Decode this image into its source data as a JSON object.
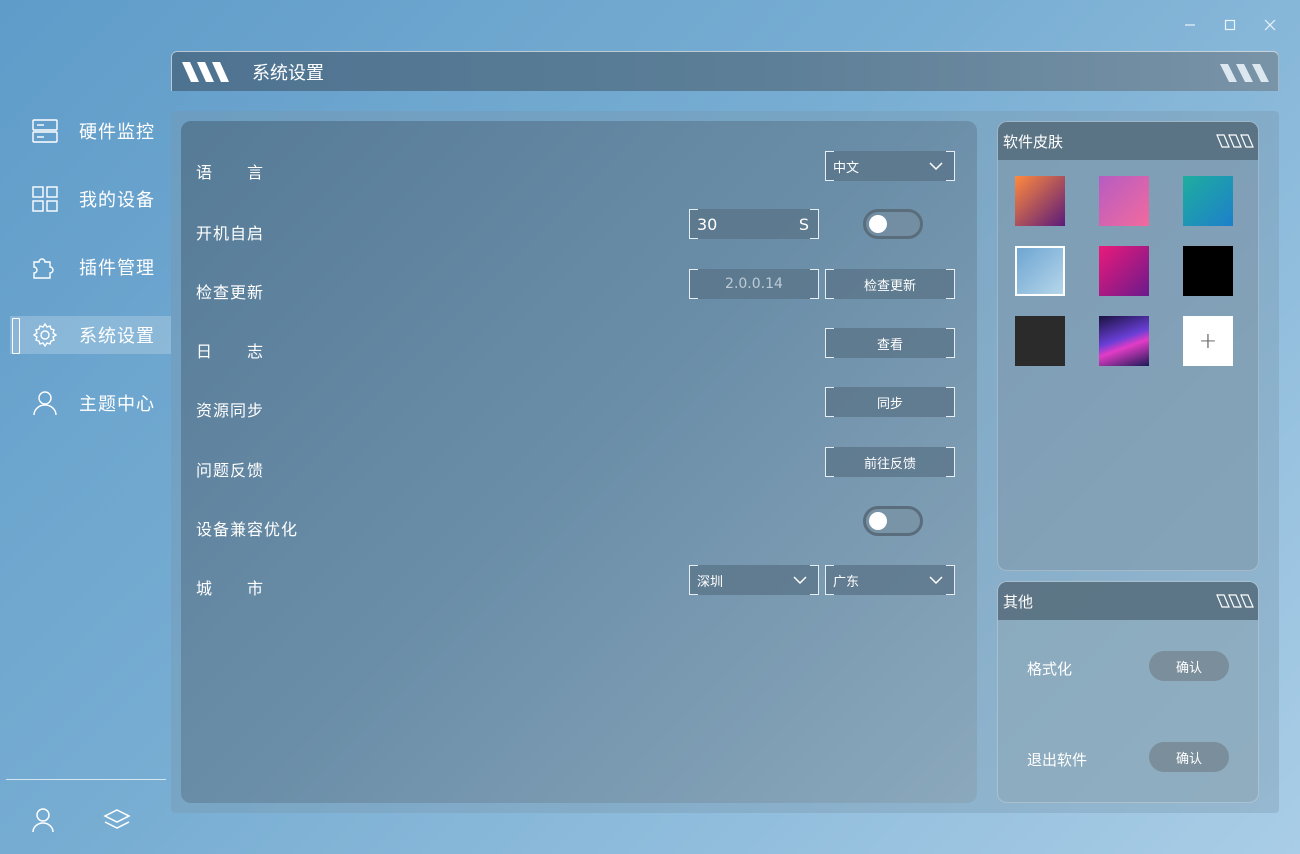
{
  "window": {
    "minimize_icon": "minimize-icon",
    "maximize_icon": "maximize-icon",
    "close_icon": "close-icon"
  },
  "sidebar": {
    "items": [
      {
        "label": "硬件监控",
        "icon": "server-icon"
      },
      {
        "label": "我的设备",
        "icon": "grid-icon"
      },
      {
        "label": "插件管理",
        "icon": "puzzle-icon"
      },
      {
        "label": "系统设置",
        "icon": "gear-icon",
        "active": true
      },
      {
        "label": "主题中心",
        "icon": "user-icon"
      }
    ],
    "bottom": [
      "user-icon",
      "layers-icon"
    ]
  },
  "header": {
    "title": "系统设置"
  },
  "settings": {
    "language": {
      "label": "语　　言",
      "value": "中文"
    },
    "autostart": {
      "label": "开机自启",
      "delay": "30",
      "unit": "S",
      "enabled": false
    },
    "update": {
      "label": "检查更新",
      "version": "2.0.0.14",
      "button": "检查更新"
    },
    "log": {
      "label": "日　　志",
      "button": "查看"
    },
    "sync": {
      "label": "资源同步",
      "button": "同步"
    },
    "feedback": {
      "label": "问题反馈",
      "button": "前往反馈"
    },
    "compat": {
      "label": "设备兼容优化",
      "enabled": false
    },
    "city": {
      "label": "城　　市",
      "city": "深圳",
      "province": "广东"
    }
  },
  "skin": {
    "title": "软件皮肤",
    "swatches": [
      {
        "name": "orange-purple",
        "bg": "linear-gradient(135deg,#ff8a3d,#5b1a7a)"
      },
      {
        "name": "violet-pink",
        "bg": "linear-gradient(135deg,#b65cc2,#f26a9e)"
      },
      {
        "name": "teal-blue",
        "bg": "linear-gradient(135deg,#1fae9e,#1d7fcb)"
      },
      {
        "name": "sky-blue",
        "bg": "linear-gradient(135deg,#6ea5d2,#b5d6ea)"
      },
      {
        "name": "magenta-purple",
        "bg": "linear-gradient(135deg,#ea1a7a,#6b1a8c)"
      },
      {
        "name": "black",
        "bg": "#000000"
      },
      {
        "name": "charcoal",
        "bg": "#2b2b2b"
      },
      {
        "name": "neon-city",
        "bg": "linear-gradient(160deg,#1a1240,#6a3fd6 45%,#e23cc6 60%,#1a1a55)"
      }
    ],
    "add_label": "+"
  },
  "other": {
    "title": "其他",
    "items": [
      {
        "label": "格式化",
        "button": "确认"
      },
      {
        "label": "退出软件",
        "button": "确认"
      }
    ]
  },
  "colors": {
    "accent": "#5a7a94",
    "panel": "#6b8ea8"
  }
}
